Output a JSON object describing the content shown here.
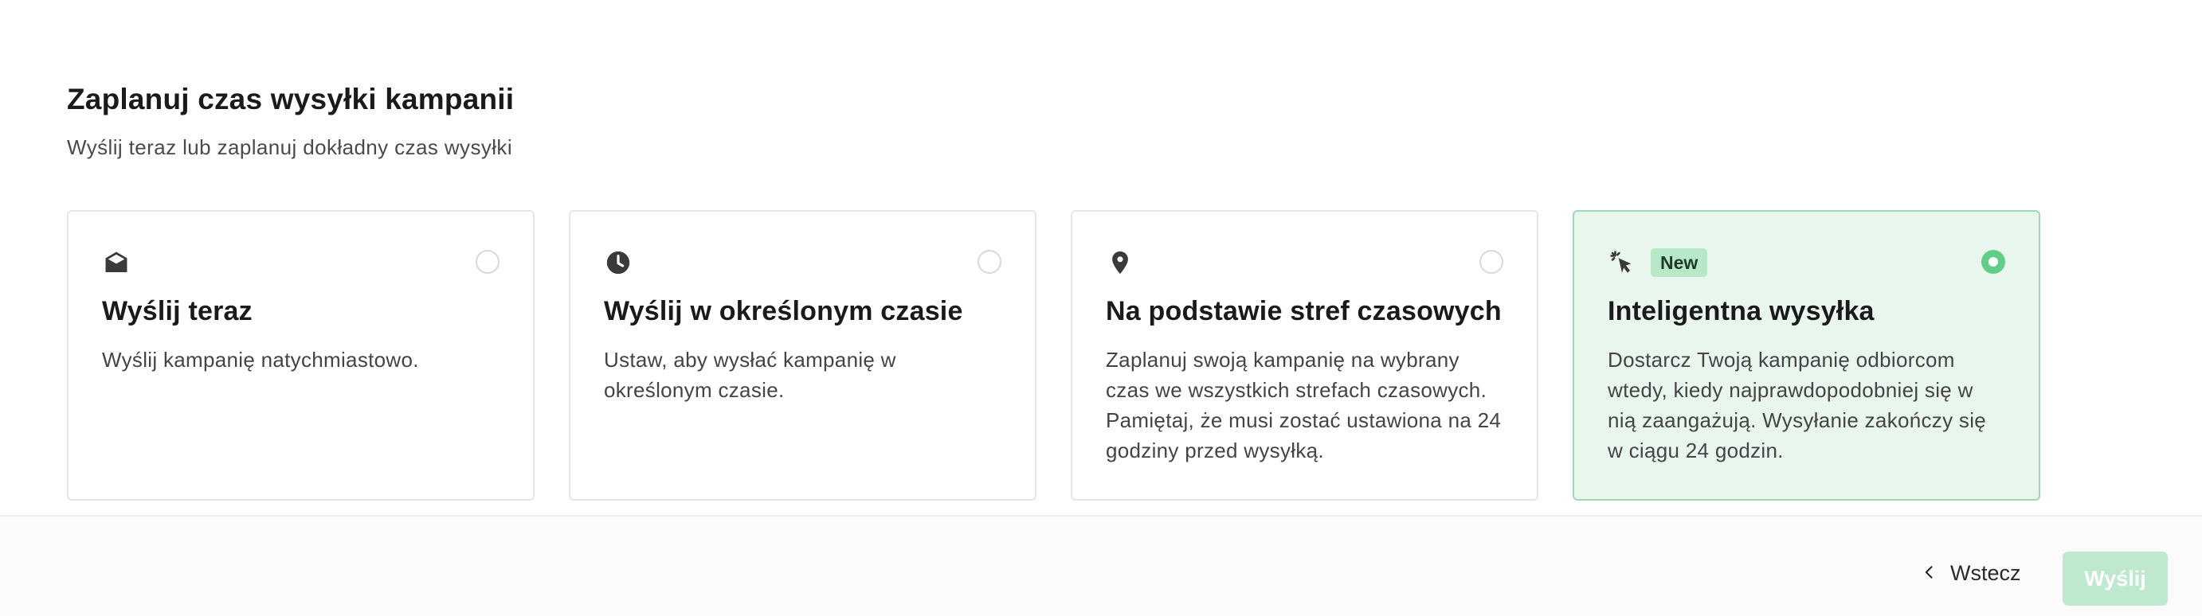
{
  "header": {
    "title": "Zaplanuj czas wysyłki kampanii",
    "subtitle": "Wyślij teraz lub zaplanuj dokładny czas wysyłki"
  },
  "cards": [
    {
      "icon": "open-envelope-icon",
      "title": "Wyślij teraz",
      "description": "Wyślij kampanię natychmiastowo.",
      "selected": false
    },
    {
      "icon": "clock-icon",
      "title": "Wyślij w określonym czasie",
      "description": "Ustaw, aby wysłać kampanię w określonym czasie.",
      "selected": false
    },
    {
      "icon": "location-pin-icon",
      "title": "Na podstawie stref czasowych",
      "description": "Zaplanuj swoją kampanię na wybrany czas we wszystkich strefach czasowych. Pamiętaj, że musi zostać ustawiona na 24 godziny przed wysyłką.",
      "selected": false
    },
    {
      "icon": "pointer-click-icon",
      "badge": "New",
      "title": "Inteligentna wysyłka",
      "description": "Dostarcz Twoją kampanię odbiorcom wtedy, kiedy najprawdopodobniej się w nią zaangażują. Wysyłanie zakończy się w ciągu 24 godzin.",
      "selected": true
    }
  ],
  "footer": {
    "back_label": "Wstecz",
    "send_label": "Wyślij"
  },
  "colors": {
    "accent": "#5fcf87",
    "selected_bg": "#e8f6ee",
    "send_button_bg": "#bfe9cf",
    "badge_bg": "#b7e8c8"
  }
}
